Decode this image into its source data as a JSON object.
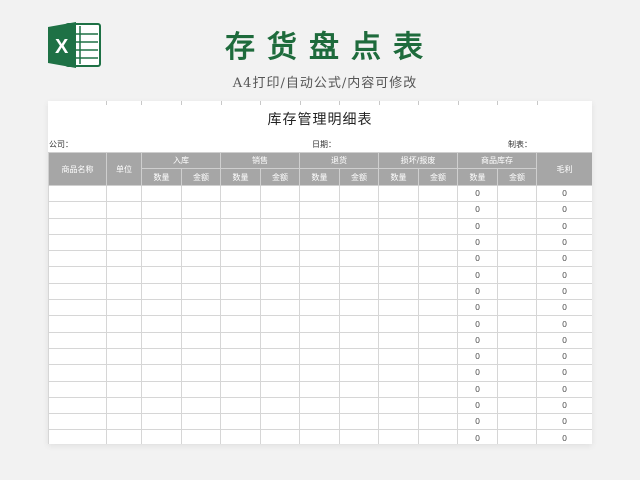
{
  "header": {
    "title": "存货盘点表",
    "subtitle": "A4打印/自动公式/内容可修改",
    "logo_letter": "X",
    "logo_color": "#1e7145"
  },
  "sheet": {
    "title": "库存管理明细表",
    "company_label": "公司：",
    "date_label": "日期：",
    "maker_label": "制表：",
    "columns": {
      "product_name": "商品名称",
      "unit": "单位",
      "inbound": "入库",
      "sales": "销售",
      "returns": "退货",
      "damaged": "损坏/报废",
      "stock": "商品库存",
      "gross_profit": "毛利",
      "qty": "数量",
      "amount": "金额"
    },
    "rows": [
      {
        "stock_qty": "0",
        "gross_profit": "0"
      },
      {
        "stock_qty": "0",
        "gross_profit": "0"
      },
      {
        "stock_qty": "0",
        "gross_profit": "0"
      },
      {
        "stock_qty": "0",
        "gross_profit": "0"
      },
      {
        "stock_qty": "0",
        "gross_profit": "0"
      },
      {
        "stock_qty": "0",
        "gross_profit": "0"
      },
      {
        "stock_qty": "0",
        "gross_profit": "0"
      },
      {
        "stock_qty": "0",
        "gross_profit": "0"
      },
      {
        "stock_qty": "0",
        "gross_profit": "0"
      },
      {
        "stock_qty": "0",
        "gross_profit": "0"
      },
      {
        "stock_qty": "0",
        "gross_profit": "0"
      },
      {
        "stock_qty": "0",
        "gross_profit": "0"
      },
      {
        "stock_qty": "0",
        "gross_profit": "0"
      },
      {
        "stock_qty": "0",
        "gross_profit": "0"
      },
      {
        "stock_qty": "0",
        "gross_profit": "0"
      },
      {
        "stock_qty": "0",
        "gross_profit": "0"
      }
    ]
  },
  "colors": {
    "title_green": "#1e6b3c",
    "header_gray": "#a6a6a6",
    "background": "#f2f2f2"
  }
}
